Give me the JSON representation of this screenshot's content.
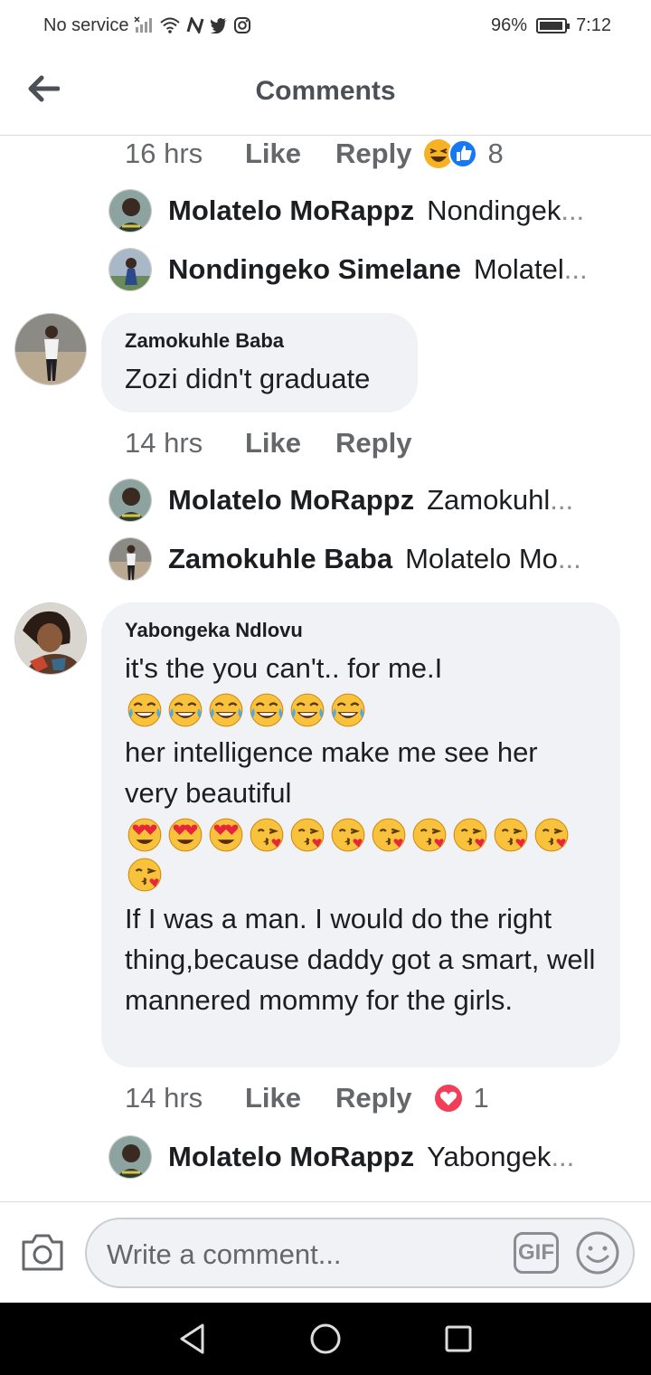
{
  "status_bar": {
    "carrier": "No service",
    "battery_percent": "96%",
    "battery_level": 0.96,
    "time": "7:12"
  },
  "header": {
    "title": "Comments"
  },
  "comment_0": {
    "time": "16 hrs",
    "like_label": "Like",
    "reply_label": "Reply",
    "reaction_count": "8",
    "replies": [
      {
        "name": "Molatelo MoRappz",
        "text": "Nondingek"
      },
      {
        "name": "Nondingeko Simelane",
        "text": "Molatel"
      }
    ]
  },
  "comment_1": {
    "author": "Zamokuhle Baba",
    "text": "Zozi didn't graduate",
    "time": "14 hrs",
    "like_label": "Like",
    "reply_label": "Reply",
    "replies": [
      {
        "name": "Molatelo MoRappz",
        "text": "Zamokuhl"
      },
      {
        "name": "Zamokuhle Baba",
        "text": "Molatelo Mo"
      }
    ]
  },
  "comment_2": {
    "author": "Yabongeka Ndlovu",
    "line1": "it's the you can't..  for me.I",
    "line2": "her intelligence make me see her very beautiful",
    "line3": "If I was a man.  I would do the right thing,because daddy got a smart, well mannered mommy for the girls.",
    "time": "14 hrs",
    "like_label": "Like",
    "reply_label": "Reply",
    "reaction_count": "1",
    "replies": [
      {
        "name": "Molatelo MoRappz",
        "text": "Yabongek"
      }
    ]
  },
  "composer": {
    "placeholder": "Write a comment...",
    "gif_label": "GIF"
  },
  "ellipsis": "...",
  "icons": {
    "back": "arrow-left-icon",
    "camera": "camera-icon",
    "emoji": "smiley-icon",
    "nav_back": "triangle-back-icon",
    "nav_home": "circle-home-icon",
    "nav_recent": "square-recent-icon",
    "laugh_emoji": "tears-of-joy-emoji",
    "heart_eyes_emoji": "heart-eyes-emoji",
    "kiss_emoji": "face-blowing-kiss-emoji"
  },
  "colors": {
    "bubble_bg": "#f0f2f5",
    "like_blue": "#1877f2",
    "love_red": "#f33e58",
    "haha_yellow": "#f7b125"
  }
}
